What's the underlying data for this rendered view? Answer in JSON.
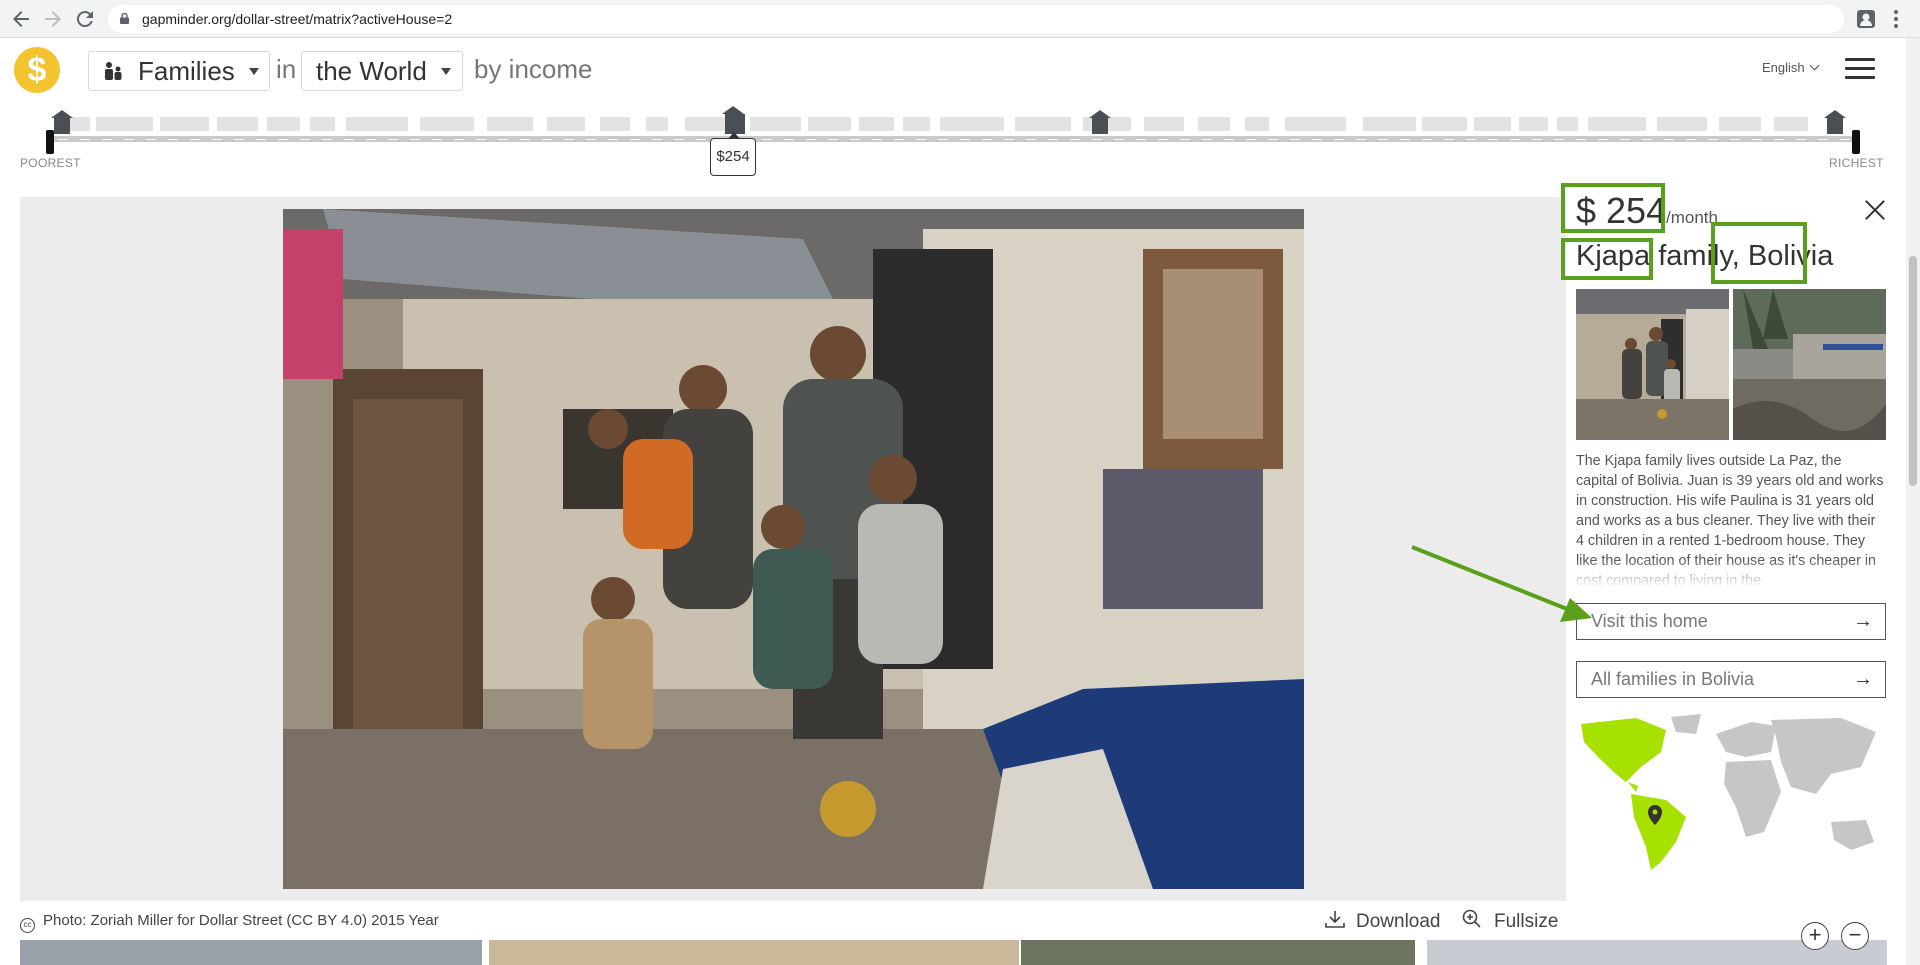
{
  "browser": {
    "url": "gapminder.org/dollar-street/matrix?activeHouse=2"
  },
  "header": {
    "logo": "$",
    "families_label": "Families",
    "in_label": "in",
    "world_label": "the World",
    "by_income_label": "by income",
    "language": "English"
  },
  "income_strip": {
    "poorest_label": "POOREST",
    "richest_label": "RICHEST",
    "selected_price": "$254"
  },
  "family": {
    "price": "$ 254",
    "per_month": "/month",
    "name": "Kjapa family, Bolivia",
    "description": "The Kjapa family lives outside La Paz, the capital of Bolivia. Juan is 39 years old and works in construction. His wife Paulina is 31 years old and works as a bus cleaner. They live with their 4 children in a rented 1-bedroom house. They like the location of their house as it's cheaper in cost compared to living in the",
    "visit_button": "Visit this home",
    "all_families_button": "All families in Bolivia"
  },
  "footer": {
    "credit": "Photo: Zoriah Miller for Dollar Street (CC BY 4.0) 2015 Year",
    "cc_mark": "cc",
    "download_label": "Download",
    "fullsize_label": "Fullsize"
  },
  "colors": {
    "highlight": "#5aa01c",
    "logo_yellow": "#f3c330",
    "map_highlight": "#a6e100",
    "map_land": "#c6c6c6"
  }
}
